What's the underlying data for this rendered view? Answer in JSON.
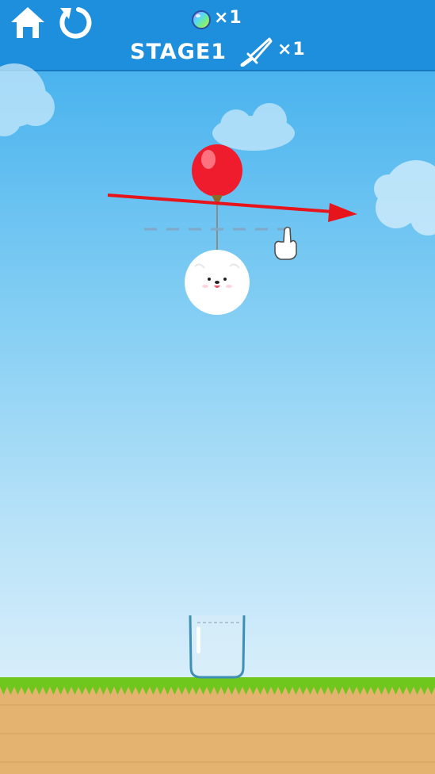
{
  "header": {
    "orb_count": "×1",
    "stage_label": "STAGE1",
    "knife_count": "×1"
  },
  "colors": {
    "header_bg": "#1e8fdc",
    "balloon": "#ee1c2d",
    "arrow": "#e8141c",
    "grass": "#7ed321",
    "dirt": "#e4b36f"
  }
}
